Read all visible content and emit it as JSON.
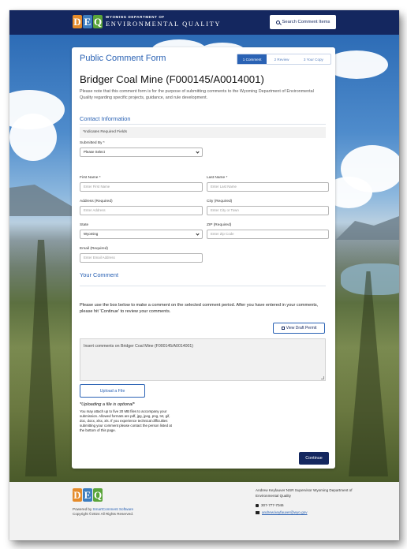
{
  "header": {
    "logo_letters": [
      "D",
      "E",
      "Q"
    ],
    "dept_line": "WYOMING DEPARTMENT OF",
    "agency_name": "ENVIRONMENTAL QUALITY",
    "search_button": "Search Comment Items",
    "search_icon": "search-icon"
  },
  "card": {
    "form_title": "Public Comment Form",
    "steps": [
      "1 Comment",
      "2 Review",
      "3 Your Copy"
    ],
    "active_step": "1 Comment",
    "document_title": "Bridger Coal Mine (F000145/A0014001)",
    "intro": "Please note that this comment form is for the purpose of submitting comments to the Wyoming Department of Environmental Quality regarding specific projects, guidance, and rule development.",
    "contact_heading": "Contact Information",
    "required_note": "*Indicates Required Fields",
    "submitted_by": {
      "label": "Submitted By *",
      "value": "Please Select"
    },
    "first_name": {
      "label": "First Name *",
      "placeholder": "Enter First Name"
    },
    "last_name": {
      "label": "Last Name *",
      "placeholder": "Enter Last Name"
    },
    "address": {
      "label": "Address (Required)",
      "placeholder": "Enter Address"
    },
    "city": {
      "label": "City (Required)",
      "placeholder": "Enter City or Town"
    },
    "state": {
      "label": "State",
      "value": "Wyoming"
    },
    "zip": {
      "label": "ZIP (Required)",
      "placeholder": "Enter Zip Code"
    },
    "email": {
      "label": "Email (Required)",
      "placeholder": "Enter Email Address"
    },
    "comment_heading": "Your Comment",
    "instructions": "Please use the box below to make a comment on the selected comment period. After you have entered in your comments, please hit 'Continue' to review your comments.",
    "view_draft_button": "View Draft Permit",
    "comment_placeholder": "Insert comments on Bridger Coal Mine (F000145/A0014001)",
    "upload_button": "Upload a File",
    "upload_optional": "*Uploading a file is optional*",
    "upload_note": "You may attach up to five 20 MB files to accompany your submission. Allowed formats are pdf, jpg, jpeg, png, txt, gif, doc, docx, xlsx, xls. If you experience technical difficulties submitting your comment please contact the person listed at the bottom of this page.",
    "continue_button": "Continue"
  },
  "footer": {
    "logo_letters": [
      "D",
      "E",
      "Q"
    ],
    "powered_by_prefix": "Powered by ",
    "powered_by_link": "SmartComment Software",
    "copyright": "Copyright ©2024 All Rights Reserved.",
    "contact_person": "Andrew Keyfauver NSR Supervisor Wyoming Department of Environmental Quality",
    "phone": "307-777-7046",
    "email": "andrew.keyfauver@wyo.gov"
  },
  "colors": {
    "navy": "#14275f",
    "accent_blue": "#2a62b4",
    "logo_orange": "#e58b2a",
    "logo_blue": "#3d7dbf",
    "logo_green": "#5aa43a"
  }
}
